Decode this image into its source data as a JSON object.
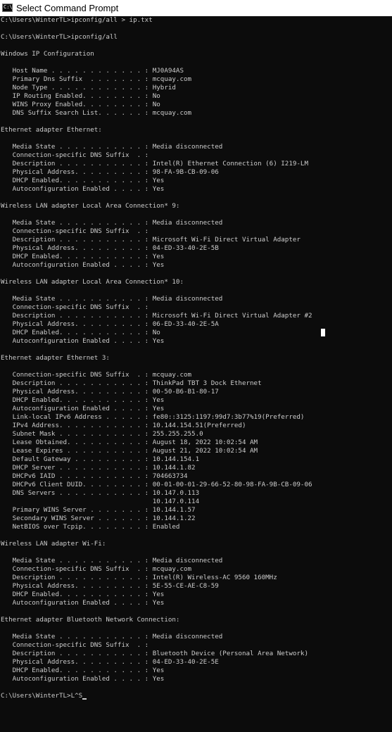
{
  "window": {
    "title": "Select Command Prompt",
    "icon": "console-icon",
    "icon_glyph": "C:\\"
  },
  "colors": {
    "background": "#0c0c0c",
    "text": "#cccccc",
    "titlebar": "#ffffff"
  },
  "console": {
    "lines": [
      "C:\\Users\\WinterTL>ipconfig/all > ip.txt",
      "",
      "C:\\Users\\WinterTL>ipconfig/all",
      "",
      "Windows IP Configuration",
      "",
      "   Host Name . . . . . . . . . . . . : MJ0A94AS",
      "   Primary Dns Suffix  . . . . . . . : mcquay.com",
      "   Node Type . . . . . . . . . . . . : Hybrid",
      "   IP Routing Enabled. . . . . . . . : No",
      "   WINS Proxy Enabled. . . . . . . . : No",
      "   DNS Suffix Search List. . . . . . : mcquay.com",
      "",
      "Ethernet adapter Ethernet:",
      "",
      "   Media State . . . . . . . . . . . : Media disconnected",
      "   Connection-specific DNS Suffix  . :",
      "   Description . . . . . . . . . . . : Intel(R) Ethernet Connection (6) I219-LM",
      "   Physical Address. . . . . . . . . : 98-FA-9B-CB-09-06",
      "   DHCP Enabled. . . . . . . . . . . : Yes",
      "   Autoconfiguration Enabled . . . . : Yes",
      "",
      "Wireless LAN adapter Local Area Connection* 9:",
      "",
      "   Media State . . . . . . . . . . . : Media disconnected",
      "   Connection-specific DNS Suffix  . :",
      "   Description . . . . . . . . . . . : Microsoft Wi-Fi Direct Virtual Adapter",
      "   Physical Address. . . . . . . . . : 04-ED-33-40-2E-5B",
      "   DHCP Enabled. . . . . . . . . . . : Yes",
      "   Autoconfiguration Enabled . . . . : Yes",
      "",
      "Wireless LAN adapter Local Area Connection* 10:",
      "",
      "   Media State . . . . . . . . . . . : Media disconnected",
      "   Connection-specific DNS Suffix  . :",
      "   Description . . . . . . . . . . . : Microsoft Wi-Fi Direct Virtual Adapter #2",
      "   Physical Address. . . . . . . . . : 06-ED-33-40-2E-5A",
      "   DHCP Enabled. . . . . . . . . . . : No",
      "   Autoconfiguration Enabled . . . . : Yes",
      "",
      "Ethernet adapter Ethernet 3:",
      "",
      "   Connection-specific DNS Suffix  . : mcquay.com",
      "   Description . . . . . . . . . . . : ThinkPad TBT 3 Dock Ethernet",
      "   Physical Address. . . . . . . . . : 00-50-B6-B1-80-17",
      "   DHCP Enabled. . . . . . . . . . . : Yes",
      "   Autoconfiguration Enabled . . . . : Yes",
      "   Link-local IPv6 Address . . . . . : fe80::3125:1197:99d7:3b77%19(Preferred)",
      "   IPv4 Address. . . . . . . . . . . : 10.144.154.51(Preferred)",
      "   Subnet Mask . . . . . . . . . . . : 255.255.255.0",
      "   Lease Obtained. . . . . . . . . . : August 18, 2022 10:02:54 AM",
      "   Lease Expires . . . . . . . . . . : August 21, 2022 10:02:54 AM",
      "   Default Gateway . . . . . . . . . : 10.144.154.1",
      "   DHCP Server . . . . . . . . . . . : 10.144.1.82",
      "   DHCPv6 IAID . . . . . . . . . . . : 704663734",
      "   DHCPv6 Client DUID. . . . . . . . : 00-01-00-01-29-66-52-80-98-FA-9B-CB-09-06",
      "   DNS Servers . . . . . . . . . . . : 10.147.0.113",
      "                                       10.147.0.114",
      "   Primary WINS Server . . . . . . . : 10.144.1.57",
      "   Secondary WINS Server . . . . . . : 10.144.1.22",
      "   NetBIOS over Tcpip. . . . . . . . : Enabled",
      "",
      "Wireless LAN adapter Wi-Fi:",
      "",
      "   Media State . . . . . . . . . . . : Media disconnected",
      "   Connection-specific DNS Suffix  . : mcquay.com",
      "   Description . . . . . . . . . . . : Intel(R) Wireless-AC 9560 160MHz",
      "   Physical Address. . . . . . . . . : 5E-55-CE-AE-C8-59",
      "   DHCP Enabled. . . . . . . . . . . : Yes",
      "   Autoconfiguration Enabled . . . . : Yes",
      "",
      "Ethernet adapter Bluetooth Network Connection:",
      "",
      "   Media State . . . . . . . . . . . : Media disconnected",
      "   Connection-specific DNS Suffix  . :",
      "   Description . . . . . . . . . . . : Bluetooth Device (Personal Area Network)",
      "   Physical Address. . . . . . . . . : 04-ED-33-40-2E-5E",
      "   DHCP Enabled. . . . . . . . . . . : Yes",
      "   Autoconfiguration Enabled . . . . : Yes",
      ""
    ],
    "prompt_line": "C:\\Users\\WinterTL>L^S"
  }
}
